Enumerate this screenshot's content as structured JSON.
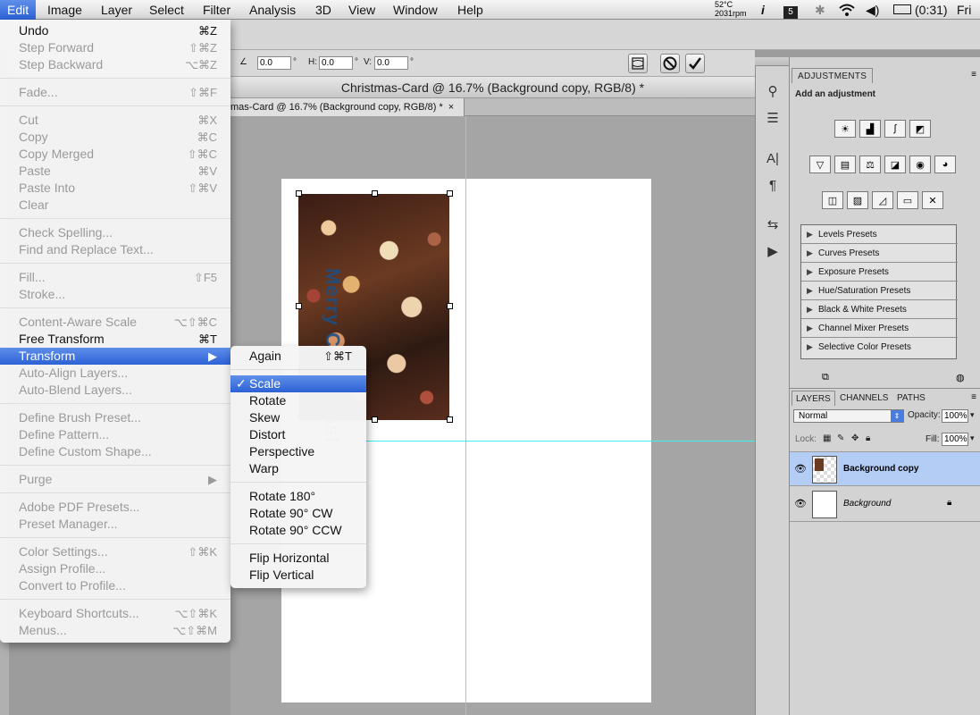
{
  "menubar": {
    "apple": "",
    "items": [
      "Edit",
      "Image",
      "Layer",
      "Select",
      "Filter",
      "Analysis",
      "3D",
      "View",
      "Window",
      "Help"
    ],
    "status": {
      "temp": "52°C",
      "rpm": "2031rpm",
      "battery": "(0:31)",
      "clock": "Fri M"
    }
  },
  "options": {
    "angle": "0.0",
    "h_label": "H:",
    "h_value": "0.0",
    "v_label": "V:",
    "v_value": "0.0",
    "deg": "°"
  },
  "document": {
    "window_title": "Christmas-Card @ 16.7% (Background copy, RGB/8) *",
    "tab_label": "mas-Card @ 16.7% (Background copy, RGB/8) *",
    "tab_close": "×",
    "greeting_text": "Merry Christmas!"
  },
  "edit_menu": {
    "items": [
      {
        "label": "Undo",
        "shortcut": "⌘Z",
        "enabled": true
      },
      {
        "label": "Step Forward",
        "shortcut": "⇧⌘Z",
        "enabled": false
      },
      {
        "label": "Step Backward",
        "shortcut": "⌥⌘Z",
        "enabled": false
      },
      {
        "label": "Fade...",
        "shortcut": "⇧⌘F",
        "enabled": false
      },
      {
        "label": "Cut",
        "shortcut": "⌘X",
        "enabled": false
      },
      {
        "label": "Copy",
        "shortcut": "⌘C",
        "enabled": false
      },
      {
        "label": "Copy Merged",
        "shortcut": "⇧⌘C",
        "enabled": false
      },
      {
        "label": "Paste",
        "shortcut": "⌘V",
        "enabled": false
      },
      {
        "label": "Paste Into",
        "shortcut": "⇧⌘V",
        "enabled": false
      },
      {
        "label": "Clear",
        "shortcut": "",
        "enabled": false
      },
      {
        "label": "Check Spelling...",
        "shortcut": "",
        "enabled": false
      },
      {
        "label": "Find and Replace Text...",
        "shortcut": "",
        "enabled": false
      },
      {
        "label": "Fill...",
        "shortcut": "⇧F5",
        "enabled": false
      },
      {
        "label": "Stroke...",
        "shortcut": "",
        "enabled": false
      },
      {
        "label": "Content-Aware Scale",
        "shortcut": "⌥⇧⌘C",
        "enabled": false
      },
      {
        "label": "Free Transform",
        "shortcut": "⌘T",
        "enabled": true
      },
      {
        "label": "Transform",
        "shortcut": "▶",
        "enabled": true
      },
      {
        "label": "Auto-Align Layers...",
        "shortcut": "",
        "enabled": false
      },
      {
        "label": "Auto-Blend Layers...",
        "shortcut": "",
        "enabled": false
      },
      {
        "label": "Define Brush Preset...",
        "shortcut": "",
        "enabled": false
      },
      {
        "label": "Define Pattern...",
        "shortcut": "",
        "enabled": false
      },
      {
        "label": "Define Custom Shape...",
        "shortcut": "",
        "enabled": false
      },
      {
        "label": "Purge",
        "shortcut": "▶",
        "enabled": false
      },
      {
        "label": "Adobe PDF Presets...",
        "shortcut": "",
        "enabled": false
      },
      {
        "label": "Preset Manager...",
        "shortcut": "",
        "enabled": false
      },
      {
        "label": "Color Settings...",
        "shortcut": "⇧⌘K",
        "enabled": false
      },
      {
        "label": "Assign Profile...",
        "shortcut": "",
        "enabled": false
      },
      {
        "label": "Convert to Profile...",
        "shortcut": "",
        "enabled": false
      },
      {
        "label": "Keyboard Shortcuts...",
        "shortcut": "⌥⇧⌘K",
        "enabled": false
      },
      {
        "label": "Menus...",
        "shortcut": "⌥⇧⌘M",
        "enabled": false
      }
    ]
  },
  "transform_menu": {
    "check": "✓",
    "items": [
      {
        "label": "Again",
        "shortcut": "⇧⌘T"
      },
      {
        "label": "Scale",
        "shortcut": ""
      },
      {
        "label": "Rotate",
        "shortcut": ""
      },
      {
        "label": "Skew",
        "shortcut": ""
      },
      {
        "label": "Distort",
        "shortcut": ""
      },
      {
        "label": "Perspective",
        "shortcut": ""
      },
      {
        "label": "Warp",
        "shortcut": ""
      },
      {
        "label": "Rotate 180°",
        "shortcut": ""
      },
      {
        "label": "Rotate 90° CW",
        "shortcut": ""
      },
      {
        "label": "Rotate 90° CCW",
        "shortcut": ""
      },
      {
        "label": "Flip Horizontal",
        "shortcut": ""
      },
      {
        "label": "Flip Vertical",
        "shortcut": ""
      }
    ]
  },
  "adjustments": {
    "tab": "ADJUSTMENTS",
    "subtitle": "Add an adjustment",
    "presets": [
      "Levels Presets",
      "Curves Presets",
      "Exposure Presets",
      "Hue/Saturation Presets",
      "Black & White Presets",
      "Channel Mixer Presets",
      "Selective Color Presets"
    ]
  },
  "layers": {
    "tabs": [
      "LAYERS",
      "CHANNELS",
      "PATHS"
    ],
    "blend_mode": "Normal",
    "opacity_label": "Opacity:",
    "opacity": "100%",
    "lock_label": "Lock:",
    "fill_label": "Fill:",
    "fill": "100%",
    "rows": [
      {
        "name": "Background copy"
      },
      {
        "name": "Background"
      }
    ]
  },
  "colors": {
    "menu_highlight": "#2c61d6",
    "guide": "#3ff0f0",
    "layer_selected": "#b4cdf5"
  }
}
